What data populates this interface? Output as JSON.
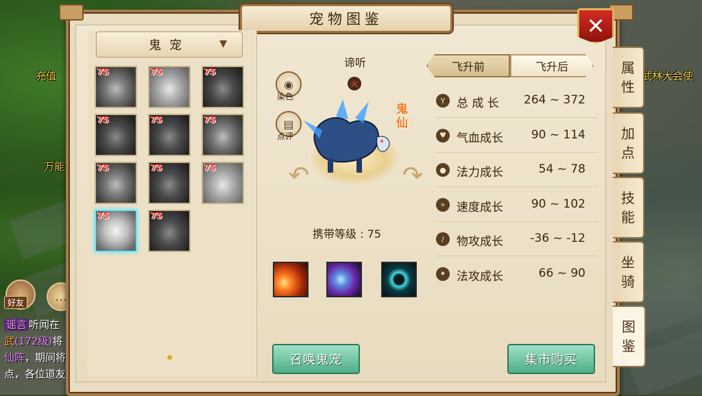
{
  "world": {
    "top_left_text": "充值",
    "mid_left_text": "万能",
    "top_right_text": "武林大会使",
    "friend_label": "好友",
    "chat_lines": [
      {
        "tag": "谣言",
        "text": "听闻在"
      },
      {
        "pre": "武",
        "pink": "(172级)",
        "text": "将"
      },
      {
        "pink": "仙阵",
        "text": "，期间将"
      },
      {
        "text": "点，各位道友"
      }
    ]
  },
  "window": {
    "title": "宠物图鉴",
    "close_icon": "close-icon"
  },
  "category_dropdown": {
    "selected": "鬼宠"
  },
  "pet_grid": [
    {
      "level": "75",
      "tone": "normal"
    },
    {
      "level": "75",
      "tone": "light"
    },
    {
      "level": "75",
      "tone": "dark"
    },
    {
      "level": "75",
      "tone": "dark"
    },
    {
      "level": "75",
      "tone": "dark"
    },
    {
      "level": "75",
      "tone": "normal"
    },
    {
      "level": "75",
      "tone": "normal"
    },
    {
      "level": "75",
      "tone": "dark"
    },
    {
      "level": "75",
      "tone": "light"
    },
    {
      "level": "75",
      "tone": "selected"
    },
    {
      "level": "75",
      "tone": "dark"
    }
  ],
  "pet": {
    "name": "谛听",
    "element": "火",
    "type_label": "鬼仙",
    "dye_label": "染色",
    "review_label": "点评",
    "carry_level": "携带等级 :  75"
  },
  "skills": [
    "fire-skill-icon",
    "water-slash-skill-icon",
    "ring-skill-icon"
  ],
  "tabs": {
    "before": "飞升前",
    "after": "飞升后"
  },
  "stats": [
    {
      "icon": "growth-icon",
      "label": "总 成 长",
      "value": "264 ~ 372"
    },
    {
      "icon": "heart-icon",
      "label": "气血成长",
      "value": "90 ~ 114"
    },
    {
      "icon": "drop-icon",
      "label": "法力成长",
      "value": "54 ~ 78"
    },
    {
      "icon": "speed-icon",
      "label": "速度成长",
      "value": "90 ~ 102"
    },
    {
      "icon": "attack-icon",
      "label": "物攻成长",
      "value": "-36 ~ -12"
    },
    {
      "icon": "magic-icon",
      "label": "法攻成长",
      "value": "66 ~ 90"
    }
  ],
  "buttons": {
    "summon": "召唤鬼宠",
    "market": "集市购买"
  },
  "side_tabs": [
    {
      "label": "属性"
    },
    {
      "label": "加点"
    },
    {
      "label": "技能"
    },
    {
      "label": "坐骑"
    },
    {
      "label": "图鉴"
    }
  ]
}
